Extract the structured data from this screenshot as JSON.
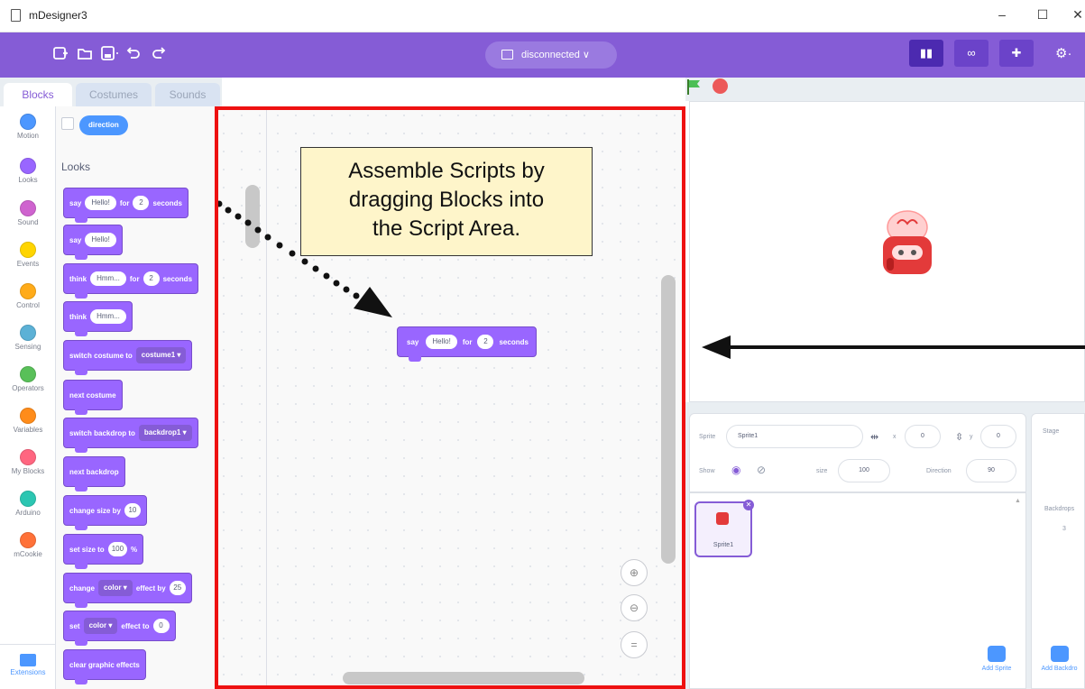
{
  "window": {
    "title": "mDesigner3",
    "minimize": "–",
    "maximize": "☐",
    "close": "✕"
  },
  "menubar": {
    "connection": "disconnected ∨",
    "mode_buttons": [
      "▮▮",
      "∞",
      "✚"
    ],
    "gear": "⚙·",
    "icons": [
      "new-file-icon",
      "open-folder-icon",
      "save-icon",
      "undo-icon",
      "redo-icon"
    ]
  },
  "tabs": [
    "Blocks",
    "Costumes",
    "Sounds"
  ],
  "categories": [
    {
      "label": "Motion",
      "color": "#4c97ff"
    },
    {
      "label": "Looks",
      "color": "#9966ff"
    },
    {
      "label": "Sound",
      "color": "#cf63cf"
    },
    {
      "label": "Events",
      "color": "#ffd500"
    },
    {
      "label": "Control",
      "color": "#ffab19"
    },
    {
      "label": "Sensing",
      "color": "#5cb1d6"
    },
    {
      "label": "Operators",
      "color": "#59c059"
    },
    {
      "label": "Variables",
      "color": "#ff8c1a"
    },
    {
      "label": "My Blocks",
      "color": "#ff6680"
    },
    {
      "label": "Arduino",
      "color": "#2cc6b2"
    },
    {
      "label": "mCookie",
      "color": "#ff7138"
    }
  ],
  "extensions_label": "Extensions",
  "palette": {
    "reporter": "direction",
    "section": "Looks",
    "blocks": {
      "say_for": {
        "a": "say",
        "msg": "Hello!",
        "b": "for",
        "num": "2",
        "c": "seconds"
      },
      "say": {
        "a": "say",
        "msg": "Hello!"
      },
      "think_for": {
        "a": "think",
        "msg": "Hmm...",
        "b": "for",
        "num": "2",
        "c": "seconds"
      },
      "think": {
        "a": "think",
        "msg": "Hmm..."
      },
      "switch_costume": {
        "a": "switch costume to",
        "dd": "costume1"
      },
      "next_costume": {
        "a": "next costume"
      },
      "switch_backdrop": {
        "a": "switch backdrop to",
        "dd": "backdrop1"
      },
      "next_backdrop": {
        "a": "next backdrop"
      },
      "change_size": {
        "a": "change size by",
        "num": "10"
      },
      "set_size": {
        "a": "set size to",
        "num": "100",
        "b": "%"
      },
      "change_effect": {
        "a": "change",
        "dd": "color",
        "b": "effect by",
        "num": "25"
      },
      "set_effect": {
        "a": "set",
        "dd": "color",
        "b": "effect to",
        "num": "0"
      },
      "clear_effects": {
        "a": "clear graphic effects"
      }
    }
  },
  "callout": {
    "line1": "Assemble Scripts by",
    "line2": "dragging Blocks into",
    "line3": "the Script Area."
  },
  "script_block": {
    "a": "say",
    "msg": "Hello!",
    "b": "for",
    "num": "2",
    "c": "seconds"
  },
  "zoom": [
    "⊕",
    "⊖",
    "="
  ],
  "sprite_info": {
    "sprite_label": "Sprite",
    "sprite_name": "Sprite1",
    "x_label": "x",
    "x_value": "0",
    "y_label": "y",
    "y_value": "0",
    "show_label": "Show",
    "size_label": "size",
    "size_value": "100",
    "direction_label": "Direction",
    "direction_value": "90"
  },
  "sprite_list": {
    "thumb_label": "Sprite1",
    "add_sprite": "Add Sprite"
  },
  "stage_panel": {
    "title": "Stage",
    "backdrops_label": "Backdrops",
    "backdrops_count": "3",
    "add_backdrop": "Add Backdro"
  }
}
